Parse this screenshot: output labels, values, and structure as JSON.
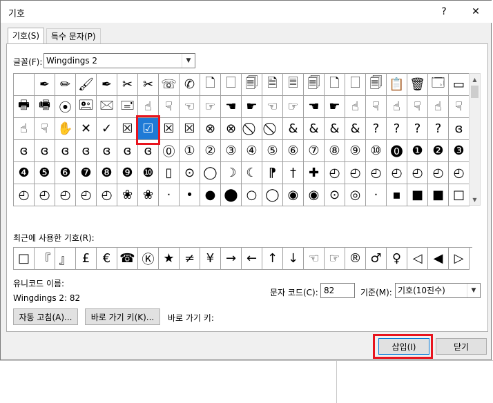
{
  "window": {
    "title": "기호",
    "help": "?",
    "close": "✕"
  },
  "tabs": [
    {
      "label": "기호(S)"
    },
    {
      "label": "특수 문자(P)"
    }
  ],
  "font": {
    "label": "글꼴(F):",
    "value": "Wingdings 2"
  },
  "grid": {
    "rows": [
      [
        "",
        "✒",
        "✏",
        "🖌",
        "✒",
        "✂",
        "✂",
        "☏",
        "✆",
        "🗋",
        "🗌",
        "🗐",
        "🗎",
        "🗏",
        "🗐",
        "🗋",
        "🗌",
        "🗐",
        "📋",
        "🗑",
        "🗔",
        "▭"
      ],
      [
        "🖶",
        "🖷",
        "⦿",
        "🖭",
        "🖂",
        "🖃",
        "☝",
        "☟",
        "☜",
        "☞",
        "☚",
        "☛",
        "☜",
        "☞",
        "☚",
        "☛",
        "☝",
        "☟",
        "☝",
        "☟",
        "☝",
        "☟"
      ],
      [
        "☝",
        "☟",
        "✋",
        "✕",
        "✓",
        "☒",
        "☑",
        "☒",
        "☒",
        "⊗",
        "⊗",
        "⃠",
        "⃠",
        "&",
        "&",
        "&",
        "&",
        "?",
        "?",
        "?",
        "?",
        "ɞ"
      ],
      [
        "ɞ",
        "ɞ",
        "ɞ",
        "ɞ",
        "ɞ",
        "ɞ",
        "ɞ",
        "⓪",
        "①",
        "②",
        "③",
        "④",
        "⑤",
        "⑥",
        "⑦",
        "⑧",
        "⑨",
        "⑩",
        "⓿",
        "❶",
        "❷",
        "❸"
      ],
      [
        "❹",
        "❺",
        "❻",
        "❼",
        "❽",
        "❾",
        "❿",
        "▯",
        "⊙",
        "◯",
        "☽",
        "☾",
        "⁋",
        "†",
        "✚",
        "◴",
        "◴",
        "◴",
        "◴",
        "◴",
        "◴",
        "◴"
      ],
      [
        "◴",
        "◴",
        "◴",
        "◴",
        "◴",
        "❀",
        "❀",
        "·",
        "•",
        "●",
        "⬤",
        "○",
        "◯",
        "◉",
        "◉",
        "⊙",
        "◎",
        "·",
        "▪",
        "■",
        "■",
        "□"
      ]
    ],
    "selected_row": 2,
    "selected_col": 6
  },
  "recent": {
    "label": "최근에 사용한 기호(R):",
    "symbols": [
      "□",
      "『",
      "』",
      "£",
      "€",
      "☎",
      "Ⓚ",
      "★",
      "≠",
      "¥",
      "→",
      "←",
      "↑",
      "↓",
      "☜",
      "☞",
      "®",
      "♂",
      "♀",
      "◁",
      "◀",
      "▷"
    ]
  },
  "unicode_name": {
    "label": "유니코드 이름:",
    "value": "Wingdings 2: 82"
  },
  "char_code": {
    "label": "문자 코드(C):",
    "value": "82"
  },
  "base": {
    "label": "기준(M):",
    "value": "기호(10진수)"
  },
  "buttons": {
    "autocorrect": "자동 고침(A)...",
    "shortcut": "바로 가기 키(K)...",
    "shortcut_label": "바로 가기 키:",
    "insert": "삽입(I)",
    "close": "닫기"
  }
}
